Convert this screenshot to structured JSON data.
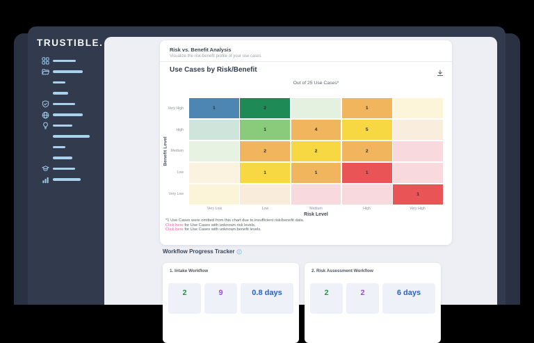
{
  "sidebar": {
    "logo": "TRUSTIBLE.",
    "items": [
      {
        "icon": "apps-icon",
        "line_width": 33
      },
      {
        "icon": "folder-icon",
        "line_width": 43
      },
      {
        "icon": null,
        "line_width": 18
      },
      {
        "icon": null,
        "line_width": 22
      },
      {
        "icon": "shield-check-icon",
        "line_width": 32
      },
      {
        "icon": "globe-icon",
        "line_width": 43
      },
      {
        "icon": "lightbulb-icon",
        "line_width": 28
      },
      {
        "icon": null,
        "line_width": 53
      },
      {
        "icon": null,
        "line_width": 18
      },
      {
        "icon": null,
        "line_width": 28
      },
      {
        "icon": "graduation-cap-icon",
        "line_width": 32
      },
      {
        "icon": "bar-chart-icon",
        "line_width": 40
      }
    ]
  },
  "panel": {
    "title": "Risk vs. Benefit Analysis",
    "subtitle": "Visualize the risk-benefit profile of your use cases",
    "chart_title": "Use Cases by Risk/Benefit",
    "chart_subtitle": "Out of 25 Use Cases*",
    "footnote": "*1 Use Cases were omitted from this chart due to insufficient risk/benefit data.",
    "links": [
      {
        "link": "Click here",
        "rest": " for Use Cases with unknown risk levels."
      },
      {
        "link": "Click here",
        "rest": " for Use Cases with unknown benefit levels."
      }
    ]
  },
  "chart_data": {
    "type": "heatmap",
    "title": "Use Cases by Risk/Benefit",
    "subtitle": "Out of 25 Use Cases*",
    "xlabel": "Risk Level",
    "ylabel": "Benefit Level",
    "x_categories": [
      "Very Low",
      "Low",
      "Medium",
      "High",
      "Very High"
    ],
    "y_categories": [
      "Very High",
      "High",
      "Medium",
      "Low",
      "Very Low"
    ],
    "rows": [
      {
        "benefit": "Very High",
        "cells": [
          {
            "v": "1",
            "c": "#4d86b3"
          },
          {
            "v": "2",
            "c": "#1e8a56"
          },
          {
            "v": "",
            "c": "#e4f0e0"
          },
          {
            "v": "1",
            "c": "#f1b55e"
          },
          {
            "v": "",
            "c": "#fcf5da"
          }
        ]
      },
      {
        "benefit": "High",
        "cells": [
          {
            "v": "",
            "c": "#cfe5db"
          },
          {
            "v": "1",
            "c": "#8aca7b"
          },
          {
            "v": "4",
            "c": "#f1b55e"
          },
          {
            "v": "5",
            "c": "#f8d842"
          },
          {
            "v": "",
            "c": "#f9eddd"
          }
        ]
      },
      {
        "benefit": "Medium",
        "cells": [
          {
            "v": "",
            "c": "#e7f2e3"
          },
          {
            "v": "2",
            "c": "#f1b55e"
          },
          {
            "v": "2",
            "c": "#f8d842"
          },
          {
            "v": "2",
            "c": "#f1b55e"
          },
          {
            "v": "",
            "c": "#f8d9dd"
          }
        ]
      },
      {
        "benefit": "Low",
        "cells": [
          {
            "v": "",
            "c": "#fcf2e0"
          },
          {
            "v": "1",
            "c": "#f8d842"
          },
          {
            "v": "1",
            "c": "#f1b55e"
          },
          {
            "v": "1",
            "c": "#e95457"
          },
          {
            "v": "",
            "c": "#f8d9dd"
          }
        ]
      },
      {
        "benefit": "Very Low",
        "cells": [
          {
            "v": "",
            "c": "#fbf4d9"
          },
          {
            "v": "",
            "c": "#f9ecdb"
          },
          {
            "v": "",
            "c": "#f8d9dd"
          },
          {
            "v": "",
            "c": "#f8d9dd"
          },
          {
            "v": "1",
            "c": "#e95457"
          }
        ]
      }
    ]
  },
  "workflow": {
    "heading": "Workflow Progress Tracker",
    "cards": [
      {
        "title": "1. Intake Workflow",
        "stats": [
          {
            "value": "2",
            "color": "#2b9348"
          },
          {
            "value": "9",
            "color": "#9c4fd6"
          },
          {
            "value": "0.8 days",
            "color": "#2362d1"
          }
        ]
      },
      {
        "title": "2. Risk Assessment Workflow",
        "stats": [
          {
            "value": "2",
            "color": "#2b9348"
          },
          {
            "value": "2",
            "color": "#9c4fd6"
          },
          {
            "value": "6 days",
            "color": "#2362d1"
          }
        ]
      }
    ]
  },
  "colors": {
    "page_background": "#000000",
    "window_back": "#2a3142",
    "window_front": "#323a4e",
    "content_background": "#edeff4",
    "skeleton_line": "#a9d2ee",
    "link": "#e8639b",
    "stat_green": "#2b9348",
    "stat_purple": "#9c4fd6",
    "stat_blue": "#2362d1"
  }
}
